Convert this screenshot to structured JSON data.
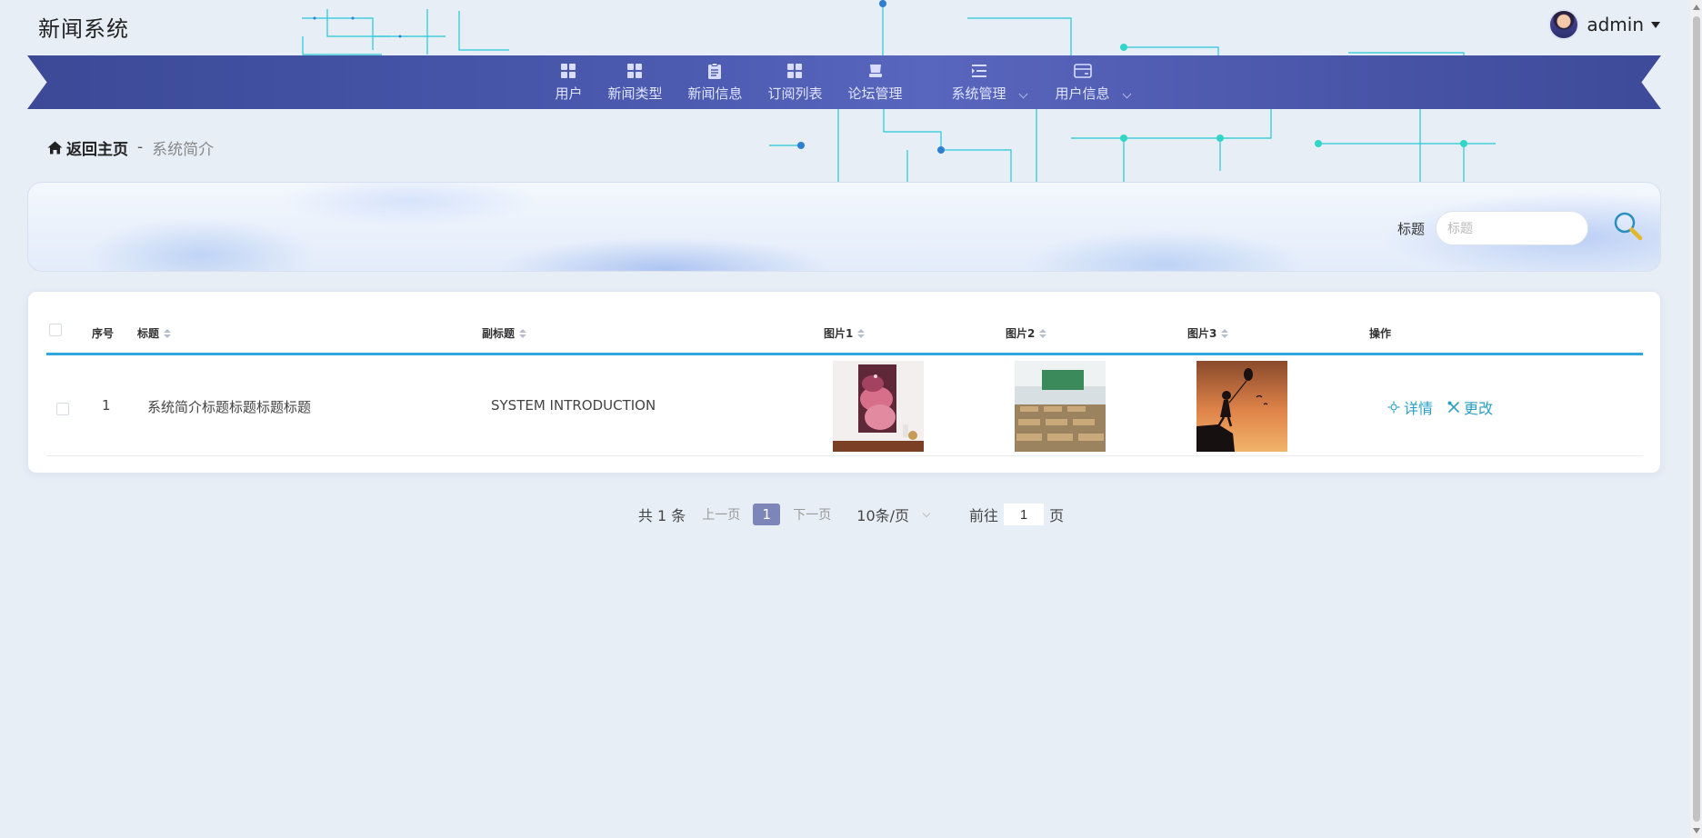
{
  "app": {
    "title": "新闻系统"
  },
  "user": {
    "name": "admin"
  },
  "nav": {
    "items": [
      {
        "label": "用户",
        "icon": "grid-icon"
      },
      {
        "label": "新闻类型",
        "icon": "grid-icon"
      },
      {
        "label": "新闻信息",
        "icon": "clipboard-icon"
      },
      {
        "label": "订阅列表",
        "icon": "grid-icon"
      },
      {
        "label": "论坛管理",
        "icon": "forum-icon"
      },
      {
        "label": "系统管理",
        "icon": "menu-list-icon"
      },
      {
        "label": "用户信息",
        "icon": "card-icon"
      }
    ]
  },
  "breadcrumb": {
    "home": "返回主页",
    "separator": "-",
    "current": "系统简介"
  },
  "search": {
    "label": "标题",
    "placeholder": "标题"
  },
  "table": {
    "headers": {
      "index": "序号",
      "title": "标题",
      "subtitle": "副标题",
      "image1": "图片1",
      "image2": "图片2",
      "image3": "图片3",
      "actions": "操作"
    },
    "rows": [
      {
        "index": "1",
        "title": "系统简介标题标题标题标题",
        "subtitle": "SYSTEM INTRODUCTION",
        "details_label": "详情",
        "edit_label": "更改"
      }
    ]
  },
  "pagination": {
    "total": "共 1 条",
    "prev": "上一页",
    "current": "1",
    "next": "下一页",
    "page_size": "10条/页",
    "goto_prefix": "前往",
    "goto_value": "1",
    "goto_suffix": "页"
  },
  "colors": {
    "nav_bg": "#4251a3",
    "accent_blue": "#2fa6e0",
    "action_teal": "#2a9fc6",
    "page_active": "#7d86b8"
  }
}
